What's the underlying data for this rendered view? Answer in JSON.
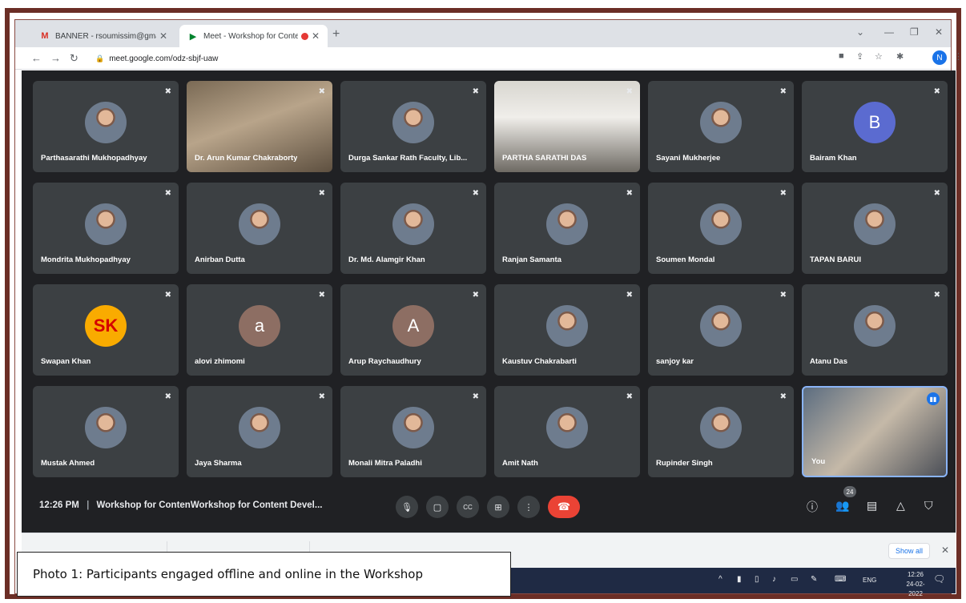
{
  "browser": {
    "tabs": [
      {
        "title": "BANNER - rsoumissim@gmail.c",
        "favicon": "gmail-icon",
        "favicon_color": "#d93025"
      },
      {
        "title": "Meet - Workshop for Conten",
        "favicon": "meet-icon",
        "favicon_color": "#00832d"
      }
    ],
    "url": "meet.google.com/odz-sbjf-uaw",
    "profile_initial": "N"
  },
  "meet": {
    "participants": [
      {
        "name": "Parthasarathi Mukhopadhyay",
        "kind": "photo"
      },
      {
        "name": "Dr. Arun Kumar Chakraborty",
        "kind": "video"
      },
      {
        "name": "Durga Sankar Rath Faculty, Lib...",
        "kind": "photo"
      },
      {
        "name": "PARTHA SARATHI DAS",
        "kind": "video2"
      },
      {
        "name": "Sayani Mukherjee",
        "kind": "photo"
      },
      {
        "name": "Bairam Khan",
        "kind": "letter",
        "letter": "B",
        "color": "#5b6bd0"
      },
      {
        "name": "Mondrita Mukhopadhyay",
        "kind": "photo"
      },
      {
        "name": "Anirban Dutta",
        "kind": "photo"
      },
      {
        "name": "Dr. Md. Alamgir Khan",
        "kind": "photo"
      },
      {
        "name": "Ranjan Samanta",
        "kind": "photo"
      },
      {
        "name": "Soumen Mondal",
        "kind": "photo"
      },
      {
        "name": "TAPAN BARUI",
        "kind": "photo"
      },
      {
        "name": "Swapan Khan",
        "kind": "letter",
        "letter": "SK",
        "color": "#f9ab00"
      },
      {
        "name": "alovi zhimomi",
        "kind": "letter",
        "letter": "a",
        "color": "#8d6e63"
      },
      {
        "name": "Arup Raychaudhury",
        "kind": "letter",
        "letter": "A",
        "color": "#8d6e63"
      },
      {
        "name": "Kaustuv Chakrabarti",
        "kind": "photo"
      },
      {
        "name": "sanjoy kar",
        "kind": "photo"
      },
      {
        "name": "Atanu Das",
        "kind": "photo"
      },
      {
        "name": "Mustak Ahmed",
        "kind": "photo"
      },
      {
        "name": "Jaya Sharma",
        "kind": "photo"
      },
      {
        "name": "Monali Mitra Paladhi",
        "kind": "photo"
      },
      {
        "name": "Amit Nath",
        "kind": "photo"
      },
      {
        "name": "Rupinder Singh",
        "kind": "photo"
      },
      {
        "name": "You",
        "kind": "self"
      }
    ],
    "time": "12:26 PM",
    "meeting_title": "Workshop for ContenWorkshop for Content Devel...",
    "people_count": "24"
  },
  "downloads": {
    "show_all": "Show all"
  },
  "taskbar": {
    "lang": "ENG",
    "time": "12:26",
    "date": "24-02-2022"
  },
  "caption": "Photo 1: Participants engaged offline and online in the Workshop"
}
